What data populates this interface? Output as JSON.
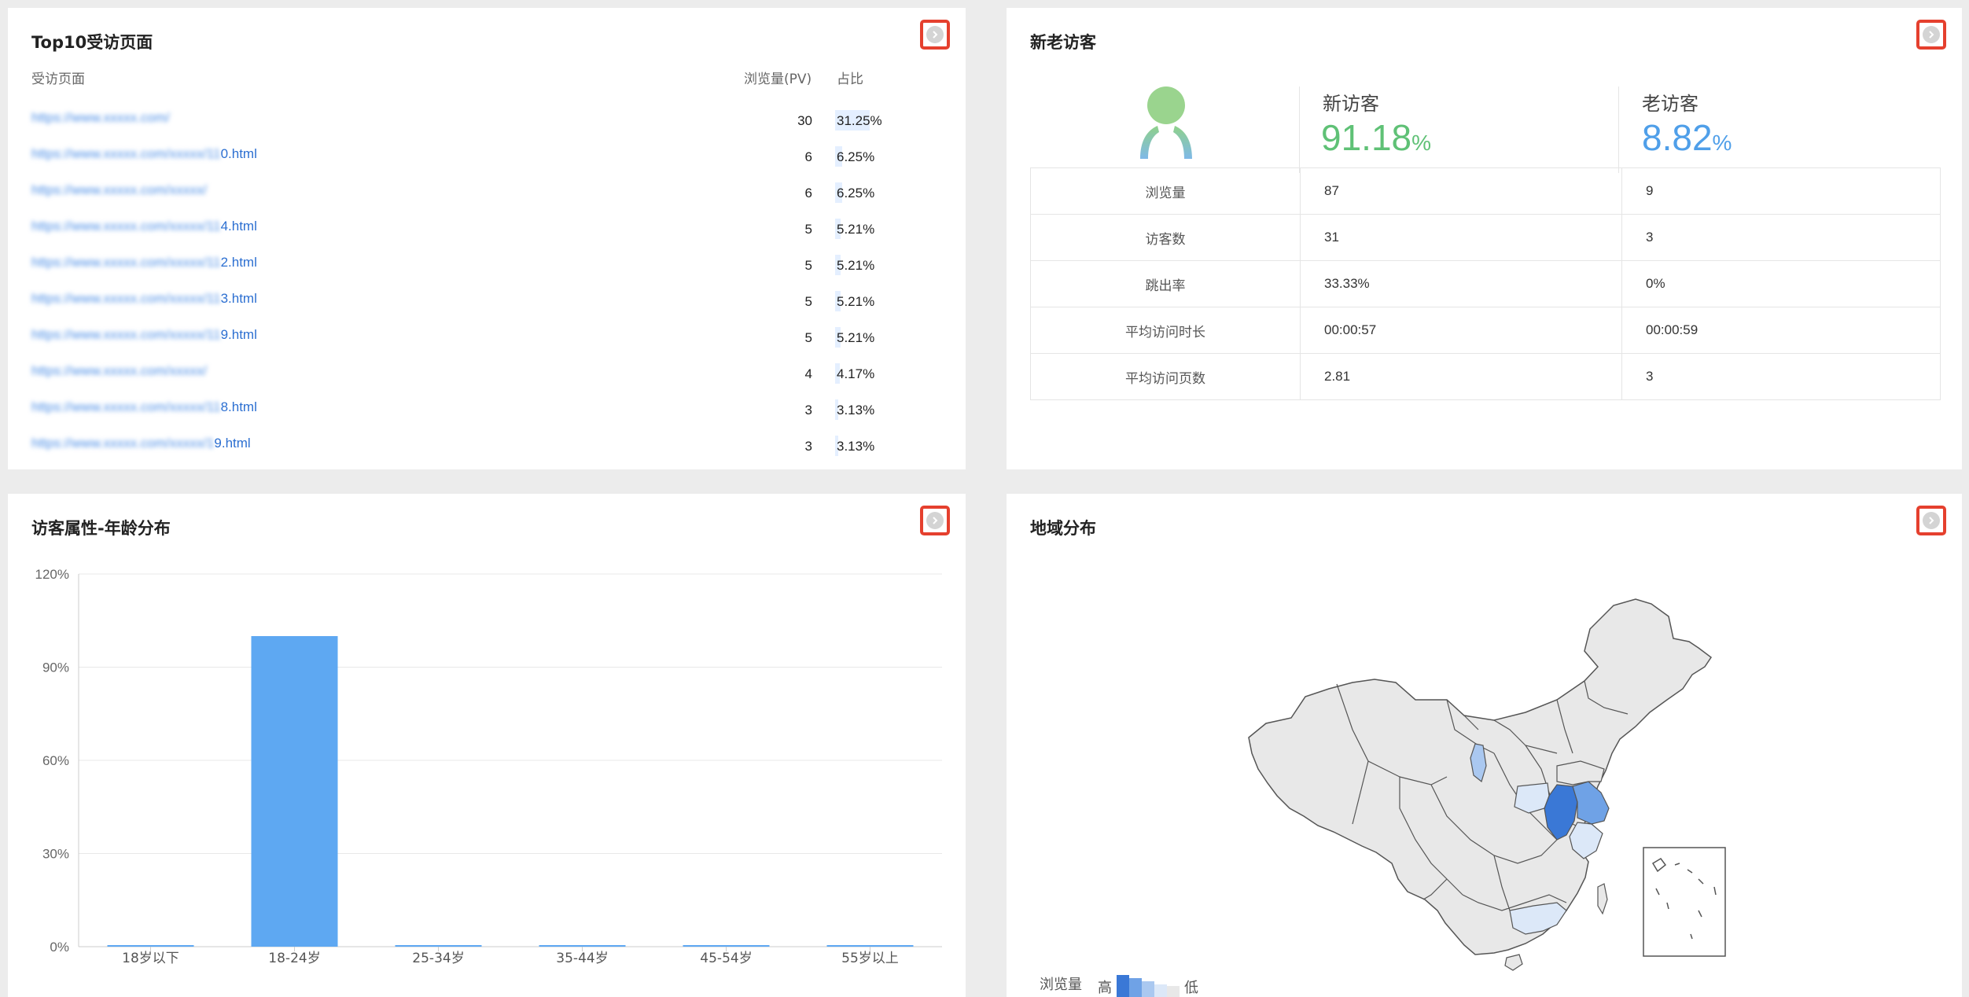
{
  "top10": {
    "title": "Top10受访页面",
    "col_page": "受访页面",
    "col_pv": "浏览量(PV)",
    "col_pct": "占比",
    "rows": [
      {
        "url_blur": "https://www.xxxxx.com/",
        "url_tail": "",
        "pv": "30",
        "pct": "31.25%",
        "ratio": 0.3125
      },
      {
        "url_blur": "https://www.xxxxx.com/xxxxx/11",
        "url_tail": "0.html",
        "pv": "6",
        "pct": "6.25%",
        "ratio": 0.0625
      },
      {
        "url_blur": "https://www.xxxxx.com/xxxxx/",
        "url_tail": "",
        "pv": "6",
        "pct": "6.25%",
        "ratio": 0.0625
      },
      {
        "url_blur": "https://www.xxxxx.com/xxxxx/11",
        "url_tail": "4.html",
        "pv": "5",
        "pct": "5.21%",
        "ratio": 0.0521
      },
      {
        "url_blur": "https://www.xxxxx.com/xxxxx/11",
        "url_tail": "2.html",
        "pv": "5",
        "pct": "5.21%",
        "ratio": 0.0521
      },
      {
        "url_blur": "https://www.xxxxx.com/xxxxx/11",
        "url_tail": "3.html",
        "pv": "5",
        "pct": "5.21%",
        "ratio": 0.0521
      },
      {
        "url_blur": "https://www.xxxxx.com/xxxxx/11",
        "url_tail": "9.html",
        "pv": "5",
        "pct": "5.21%",
        "ratio": 0.0521
      },
      {
        "url_blur": "https://www.xxxxx.com/xxxxx/",
        "url_tail": "",
        "pv": "4",
        "pct": "4.17%",
        "ratio": 0.0417
      },
      {
        "url_blur": "https://www.xxxxx.com/xxxxx/11",
        "url_tail": "8.html",
        "pv": "3",
        "pct": "3.13%",
        "ratio": 0.0313
      },
      {
        "url_blur": "https://www.xxxxx.com/xxxxx/1",
        "url_tail": "9.html",
        "pv": "3",
        "pct": "3.13%",
        "ratio": 0.0313
      }
    ]
  },
  "visitors": {
    "title": "新老访客",
    "new_label": "新访客",
    "new_value": "91.18",
    "old_label": "老访客",
    "old_value": "8.82",
    "percent_sign": "%",
    "new_color": "#5fc176",
    "old_color": "#4f9fe9",
    "rows": [
      {
        "label": "浏览量",
        "new": "87",
        "old": "9"
      },
      {
        "label": "访客数",
        "new": "31",
        "old": "3"
      },
      {
        "label": "跳出率",
        "new": "33.33%",
        "old": "0%"
      },
      {
        "label": "平均访问时长",
        "new": "00:00:57",
        "old": "00:00:59"
      },
      {
        "label": "平均访问页数",
        "new": "2.81",
        "old": "3"
      }
    ]
  },
  "age": {
    "title": "访客属性-年龄分布",
    "bar_color": "#5ea8f2"
  },
  "region": {
    "title": "地域分布",
    "legend_label": "浏览量",
    "legend_high": "高",
    "legend_low": "低",
    "palette": [
      "#3a78d6",
      "#6fa2e6",
      "#aac8f0",
      "#dce8f8",
      "#e8e8e8"
    ]
  },
  "chart_data": {
    "type": "bar",
    "title": "访客属性-年龄分布",
    "categories": [
      "18岁以下",
      "18-24岁",
      "25-34岁",
      "35-44岁",
      "45-54岁",
      "55岁以上"
    ],
    "values": [
      0,
      100,
      0,
      0,
      0,
      0
    ],
    "yticks": [
      "0%",
      "30%",
      "60%",
      "90%",
      "120%"
    ],
    "ylim": [
      0,
      120
    ],
    "grid": true,
    "xlabel": "",
    "ylabel": ""
  }
}
